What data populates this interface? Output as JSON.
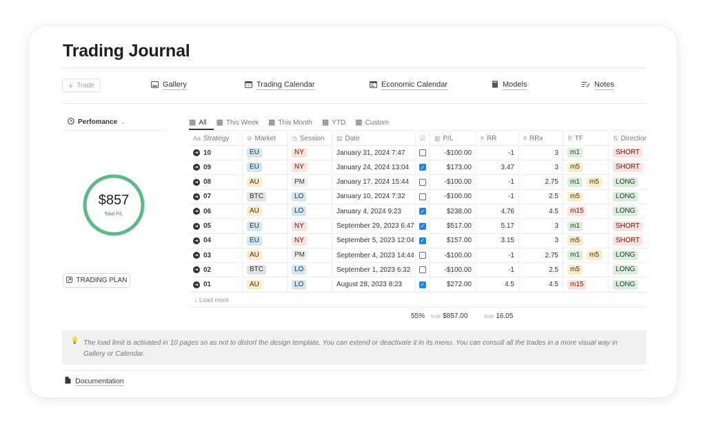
{
  "page": {
    "title": "Trading Journal"
  },
  "nav": {
    "add_label": "Trade",
    "links": [
      {
        "label": "Gallery",
        "icon": "image-icon"
      },
      {
        "label": "Trading Calendar",
        "icon": "calendar-icon"
      },
      {
        "label": "Economic Calendar",
        "icon": "window-icon"
      },
      {
        "label": "Models",
        "icon": "book-icon"
      },
      {
        "label": "Notes",
        "icon": "notes-icon"
      }
    ]
  },
  "performance": {
    "label": "Perfomance",
    "total_value": "$857",
    "total_label": "Total P/L",
    "ring_fill": 1.0,
    "ring_colors": {
      "main": "#5fb88a",
      "light": "#a9d9bd"
    }
  },
  "trading_plan": {
    "label": "TRADING PLAN"
  },
  "tabs": [
    {
      "label": "All",
      "active": true
    },
    {
      "label": "This Week",
      "active": false
    },
    {
      "label": "This Month",
      "active": false
    },
    {
      "label": "YTD",
      "active": false
    },
    {
      "label": "Custom",
      "active": false
    }
  ],
  "table": {
    "headers": {
      "strategy": "Strategy",
      "market": "Market",
      "session": "Session",
      "date": "Date",
      "pl": "P/L",
      "rr": "RR",
      "rrx": "RRx",
      "tf": "TF",
      "direction": "Direction"
    },
    "rows": [
      {
        "strategy": "10",
        "market": "EU",
        "session": "NY",
        "date": "January 31, 2024 7:47",
        "checked": false,
        "pl": "-$100.00",
        "rr": "-1",
        "rrx": "3",
        "tf": [
          "m1"
        ],
        "direction": "SHORT"
      },
      {
        "strategy": "09",
        "market": "EU",
        "session": "NY",
        "date": "January 24, 2024 13:04",
        "checked": true,
        "pl": "$173.00",
        "rr": "3.47",
        "rrx": "3",
        "tf": [
          "m5"
        ],
        "direction": "SHORT"
      },
      {
        "strategy": "08",
        "market": "AU",
        "session": "PM",
        "date": "January 17, 2024 15:44",
        "checked": false,
        "pl": "-$100.00",
        "rr": "-1",
        "rrx": "2.75",
        "tf": [
          "m1",
          "m5"
        ],
        "direction": "LONG"
      },
      {
        "strategy": "07",
        "market": "BTC",
        "session": "LO",
        "date": "January 10, 2024 7:32",
        "checked": false,
        "pl": "-$100.00",
        "rr": "-1",
        "rrx": "2.5",
        "tf": [
          "m5"
        ],
        "direction": "LONG"
      },
      {
        "strategy": "06",
        "market": "AU",
        "session": "LO",
        "date": "January 4, 2024 9:23",
        "checked": true,
        "pl": "$238.00",
        "rr": "4.76",
        "rrx": "4.5",
        "tf": [
          "m15"
        ],
        "direction": "LONG"
      },
      {
        "strategy": "05",
        "market": "EU",
        "session": "NY",
        "date": "September 29, 2023 6:47",
        "checked": true,
        "pl": "$517.00",
        "rr": "5.17",
        "rrx": "3",
        "tf": [
          "m1"
        ],
        "direction": "SHORT"
      },
      {
        "strategy": "04",
        "market": "EU",
        "session": "NY",
        "date": "September 5, 2023 12:04",
        "checked": true,
        "pl": "$157.00",
        "rr": "3.15",
        "rrx": "3",
        "tf": [
          "m5"
        ],
        "direction": "SHORT"
      },
      {
        "strategy": "03",
        "market": "AU",
        "session": "PM",
        "date": "September 4, 2023 14:44",
        "checked": false,
        "pl": "-$100.00",
        "rr": "-1",
        "rrx": "2.75",
        "tf": [
          "m1",
          "m5"
        ],
        "direction": "LONG"
      },
      {
        "strategy": "02",
        "market": "BTC",
        "session": "LO",
        "date": "September 1, 2023 6:32",
        "checked": false,
        "pl": "-$100.00",
        "rr": "-1",
        "rrx": "2.5",
        "tf": [
          "m5"
        ],
        "direction": "LONG"
      },
      {
        "strategy": "01",
        "market": "AU",
        "session": "LO",
        "date": "August 28, 2023 8:23",
        "checked": true,
        "pl": "$272.00",
        "rr": "4.5",
        "rrx": "4.5",
        "tf": [
          "m15"
        ],
        "direction": "LONG"
      }
    ],
    "load_more": "Load more",
    "footer": {
      "pct": "55%",
      "sum_key": "SUM",
      "pl_sum": "$857.00",
      "rr_sum": "16.05"
    }
  },
  "callout": {
    "icon": "lightbulb-icon",
    "text": "The load limit is activated in 10 pages so as not to distort the design template. You can extend or deactivate it in its menu. You can consult all the trades in a more visual way in Gallery or Calendar."
  },
  "documentation": {
    "label": "Documentation"
  }
}
